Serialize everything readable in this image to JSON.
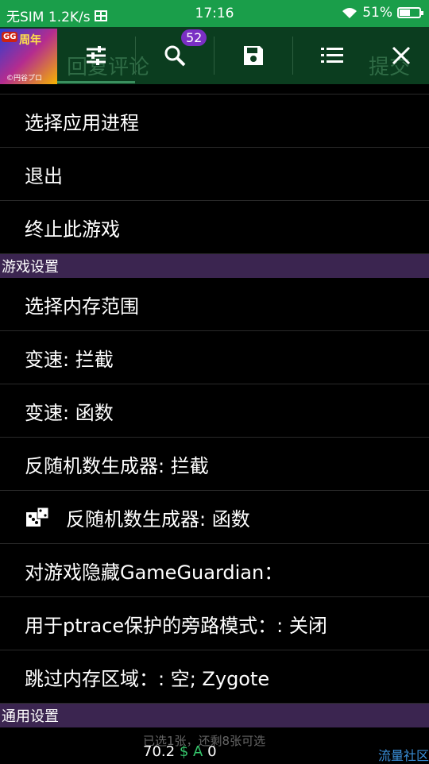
{
  "status_bar": {
    "carrier": "无SIM 1.2K/s",
    "time": "17:16",
    "battery": "51%",
    "battery_level": 0.51
  },
  "toolbar": {
    "under_left": "回复评论",
    "under_right": "提交",
    "search_badge": "52",
    "app_badge_gg": "GG",
    "app_badge_text": "周年",
    "app_caption": "©円谷プロ"
  },
  "menu": {
    "items_top": [
      "选择应用进程",
      "退出",
      "终止此游戏"
    ],
    "section_game": "游戏设置",
    "items_game": [
      "选择内存范围",
      "变速: 拦截",
      "变速: 函数",
      "反随机数生成器: 拦截",
      "反随机数生成器: 函数",
      "对游戏隐藏GameGuardian：",
      "用于ptrace保护的旁路模式：: 关闭",
      "跳过内存区域：: 空; Zygote"
    ],
    "section_general": "通用设置"
  },
  "footer": {
    "ghost_text": "已选1张，还剩8张可选",
    "value": "70.2",
    "dollar": "$",
    "a_label": "A",
    "a_value": "0",
    "community": "流量社区"
  },
  "colors": {
    "status_bar": "#1a9e4a",
    "toolbar": "#0b3d1f",
    "section": "#3b2550",
    "badge": "#7a2fc4"
  }
}
